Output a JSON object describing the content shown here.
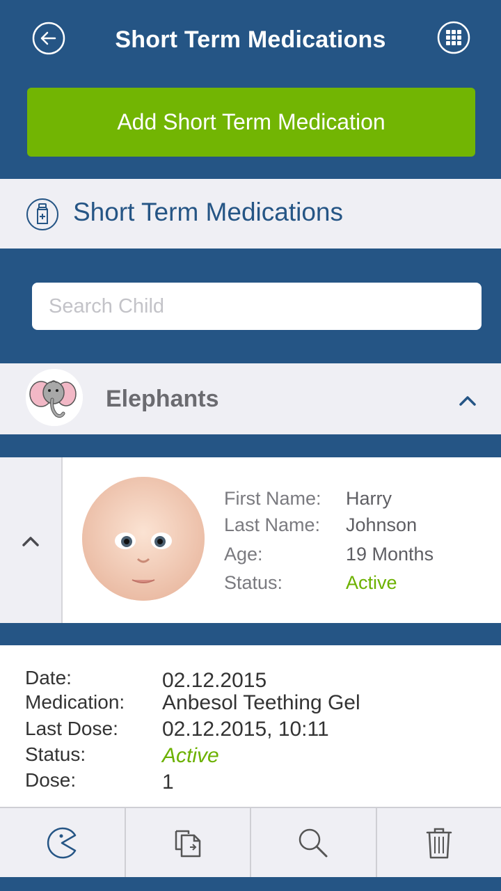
{
  "header": {
    "title": "Short Term Medications",
    "add_button_label": "Add Short Term Medication"
  },
  "section": {
    "label": "Short Term Medications"
  },
  "search": {
    "placeholder": "Search Child"
  },
  "group": {
    "name": "Elephants"
  },
  "child": {
    "first_name_label": "First Name:",
    "first_name": "Harry",
    "last_name_label": "Last Name:",
    "last_name": "Johnson",
    "age_label": "Age:",
    "age": "19 Months",
    "status_label": "Status:",
    "status": "Active"
  },
  "medication": {
    "date_label": "Date:",
    "date": "02.12.2015",
    "medication_label": "Medication:",
    "medication": "Anbesol Teething Gel",
    "last_dose_label": "Last Dose:",
    "last_dose": "02.12.2015, 10:11",
    "status_label": "Status:",
    "status": "Active",
    "dose_label": "Dose:",
    "dose": "1"
  },
  "toolbar": {
    "icons": [
      "pacman-icon",
      "copy-icon",
      "search-icon",
      "trash-icon"
    ]
  },
  "colors": {
    "primary": "#255585",
    "accent_green": "#72b503",
    "status_green": "#6cb100",
    "light_bg": "#efeff4"
  }
}
